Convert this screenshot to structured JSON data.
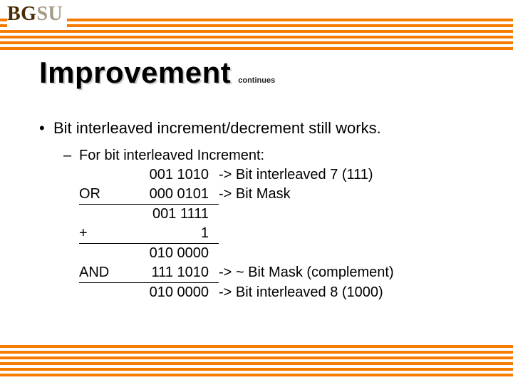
{
  "logo": {
    "part1": "BG",
    "part2": "SU"
  },
  "title": "Improvement",
  "subtitle": "continues",
  "bullet_main": "Bit interleaved increment/decrement still works.",
  "bullet_sub": "For bit interleaved Increment:",
  "rows": [
    {
      "op": "",
      "bin": "001 1010",
      "ann": "-> Bit interleaved 7 (111)",
      "underline": false
    },
    {
      "op": "OR",
      "bin": "000 0101",
      "ann": "-> Bit Mask",
      "underline": true
    },
    {
      "op": "",
      "bin": "001 1111",
      "ann": "",
      "underline": false
    },
    {
      "op": "+",
      "bin": "1",
      "ann": "",
      "underline": true
    },
    {
      "op": "",
      "bin": "010 0000",
      "ann": "",
      "underline": false
    },
    {
      "op": "AND",
      "bin": "111 1010",
      "ann": "-> ~ Bit Mask (complement)",
      "underline": true
    },
    {
      "op": "",
      "bin": "010 0000",
      "ann": "-> Bit interleaved 8 (1000)",
      "underline": false
    }
  ]
}
